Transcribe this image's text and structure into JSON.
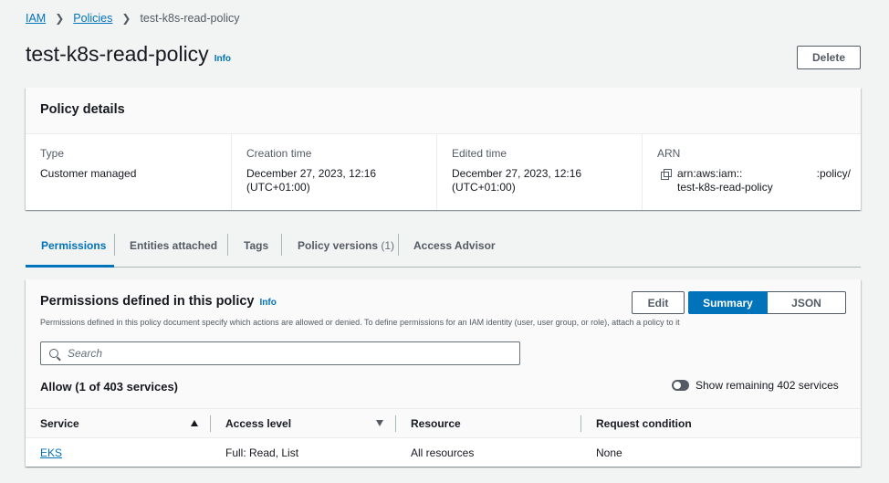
{
  "breadcrumb": {
    "root": "IAM",
    "parent": "Policies",
    "current": "test-k8s-read-policy"
  },
  "page": {
    "title": "test-k8s-read-policy",
    "info_label": "Info",
    "delete_label": "Delete"
  },
  "policy_details": {
    "heading": "Policy details",
    "fields": [
      {
        "label": "Type",
        "value": "Customer managed"
      },
      {
        "label": "Creation time",
        "value": "December 27, 2023, 12:16 (UTC+01:00)"
      },
      {
        "label": "Edited time",
        "value": "December 27, 2023, 12:16 (UTC+01:00)"
      }
    ],
    "arn": {
      "label": "ARN",
      "line1_prefix": "arn:aws:iam::",
      "line1_suffix": ":policy/",
      "line2": "test-k8s-read-policy"
    }
  },
  "tabs": [
    {
      "label": "Permissions",
      "active": true
    },
    {
      "label": "Entities attached"
    },
    {
      "label": "Tags"
    },
    {
      "label": "Policy versions",
      "count": "(1)"
    },
    {
      "label": "Access Advisor"
    }
  ],
  "permissions": {
    "heading": "Permissions defined in this policy",
    "info_label": "Info",
    "description": "Permissions defined in this policy document specify which actions are allowed or denied. To define permissions for an IAM identity (user, user group, or role), attach a policy to it",
    "edit_label": "Edit",
    "summary_label": "Summary",
    "json_label": "JSON",
    "search_placeholder": "Search",
    "allow_title": "Allow (1 of 403 services)",
    "toggle_label": "Show remaining 402 services",
    "columns": [
      "Service",
      "Access level",
      "Resource",
      "Request condition"
    ],
    "rows": [
      {
        "service": "EKS",
        "access_level": "Full: Read, List",
        "resource": "All resources",
        "condition": "None"
      }
    ]
  }
}
